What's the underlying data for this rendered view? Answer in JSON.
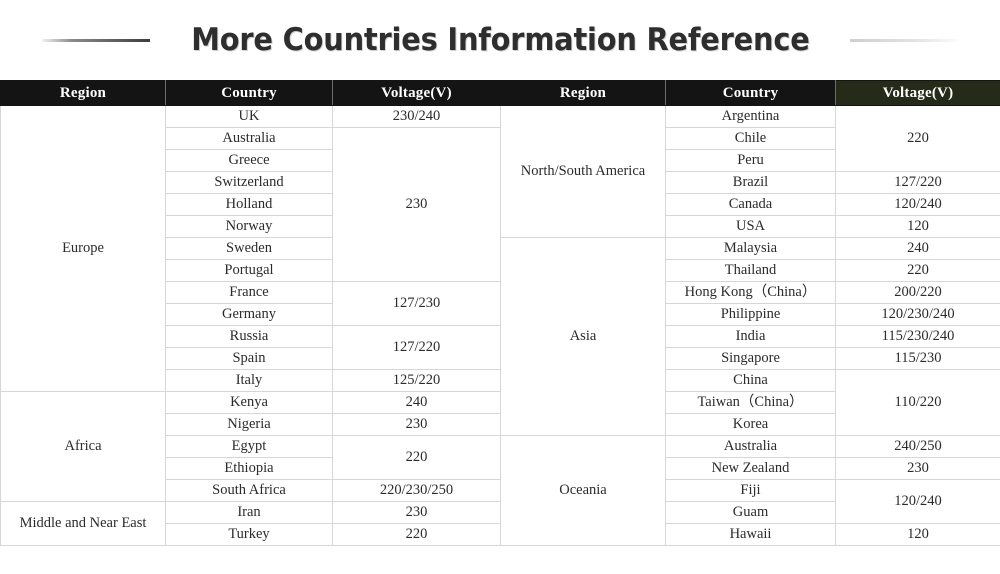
{
  "title": "More Countries Information Reference",
  "colors": {
    "header_bg": "#141414",
    "header_tint_bg": "#262a18",
    "region_shade_light": "#f2f2f2",
    "region_shade_mid": "#e7e7e7",
    "region_shade_dark": "#d9d9d9",
    "grid_line": "#d6d6d6",
    "text": "#2b2b2b"
  },
  "headers": {
    "region": "Region",
    "country": "Country",
    "voltage": "Voltage(V)"
  },
  "left_table": {
    "regions": [
      {
        "name": "Europe",
        "shade": "shade-a",
        "rows": 13,
        "countries": [
          "UK",
          "Australia",
          "Greece",
          "Switzerland",
          "Holland",
          "Norway",
          "Sweden",
          "Portugal",
          "France",
          "Germany",
          "Russia",
          "Spain",
          "Italy"
        ],
        "voltages": [
          {
            "value": "230/240",
            "span": 1
          },
          {
            "value": "230",
            "span": 7
          },
          {
            "value": "127/230",
            "span": 2
          },
          {
            "value": "127/220",
            "span": 2
          },
          {
            "value": "125/220",
            "span": 1
          }
        ]
      },
      {
        "name": "Africa",
        "shade": "shade-b",
        "rows": 5,
        "countries": [
          "Kenya",
          "Nigeria",
          "Egypt",
          "Ethiopia",
          "South Africa"
        ],
        "voltages": [
          {
            "value": "240",
            "span": 1
          },
          {
            "value": "230",
            "span": 1
          },
          {
            "value": "220",
            "span": 2
          },
          {
            "value": "220/230/250",
            "span": 1
          }
        ]
      },
      {
        "name": "Middle and Near East",
        "shade": "shade-c",
        "rows": 2,
        "countries": [
          "Iran",
          "Turkey"
        ],
        "voltages": [
          {
            "value": "230",
            "span": 1
          },
          {
            "value": "220",
            "span": 1
          }
        ]
      }
    ]
  },
  "right_table": {
    "regions": [
      {
        "name": "North/South America",
        "shade": "shade-c",
        "rows": 6,
        "countries": [
          "Argentina",
          "Chile",
          "Peru",
          "Brazil",
          "Canada",
          "USA"
        ],
        "voltages": [
          {
            "value": "220",
            "span": 3
          },
          {
            "value": "127/220",
            "span": 1
          },
          {
            "value": "120/240",
            "span": 1
          },
          {
            "value": "120",
            "span": 1
          }
        ]
      },
      {
        "name": "Asia",
        "shade": "shade-d",
        "rows": 9,
        "countries": [
          "Malaysia",
          "Thailand",
          "Hong Kong（China）",
          "Philippine",
          "India",
          "Singapore",
          "China",
          "Taiwan（China）",
          "Korea"
        ],
        "voltages": [
          {
            "value": "240",
            "span": 1
          },
          {
            "value": "220",
            "span": 1
          },
          {
            "value": "200/220",
            "span": 1
          },
          {
            "value": "120/230/240",
            "span": 1
          },
          {
            "value": "115/230/240",
            "span": 1
          },
          {
            "value": "115/230",
            "span": 1
          },
          {
            "value": "110/220",
            "span": 3
          }
        ]
      },
      {
        "name": "Oceania",
        "shade": "shade-a",
        "rows": 5,
        "countries": [
          "Australia",
          "New Zealand",
          "Fiji",
          "Guam",
          "Hawaii"
        ],
        "voltages": [
          {
            "value": "240/250",
            "span": 1
          },
          {
            "value": "230",
            "span": 1
          },
          {
            "value": "120/240",
            "span": 2
          },
          {
            "value": "120",
            "span": 1
          }
        ]
      }
    ]
  }
}
